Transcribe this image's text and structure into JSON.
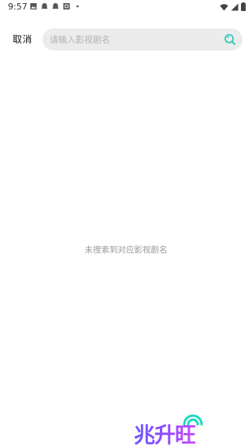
{
  "status_bar": {
    "time": "9:57",
    "left_icons": [
      "image-icon",
      "notification-icon",
      "notification-icon",
      "app-icon",
      "dot-icon"
    ],
    "right_icons": [
      "wifi-icon",
      "signal-icon",
      "battery-icon"
    ]
  },
  "header": {
    "cancel_label": "取消",
    "search_placeholder": "请输入影视剧名",
    "search_value": "",
    "search_icon": "search-icon",
    "accent_color": "#1ec8b0"
  },
  "empty_state": {
    "message": "未搜索到对应影视剧名"
  },
  "watermark": {
    "text": "兆升旺"
  }
}
